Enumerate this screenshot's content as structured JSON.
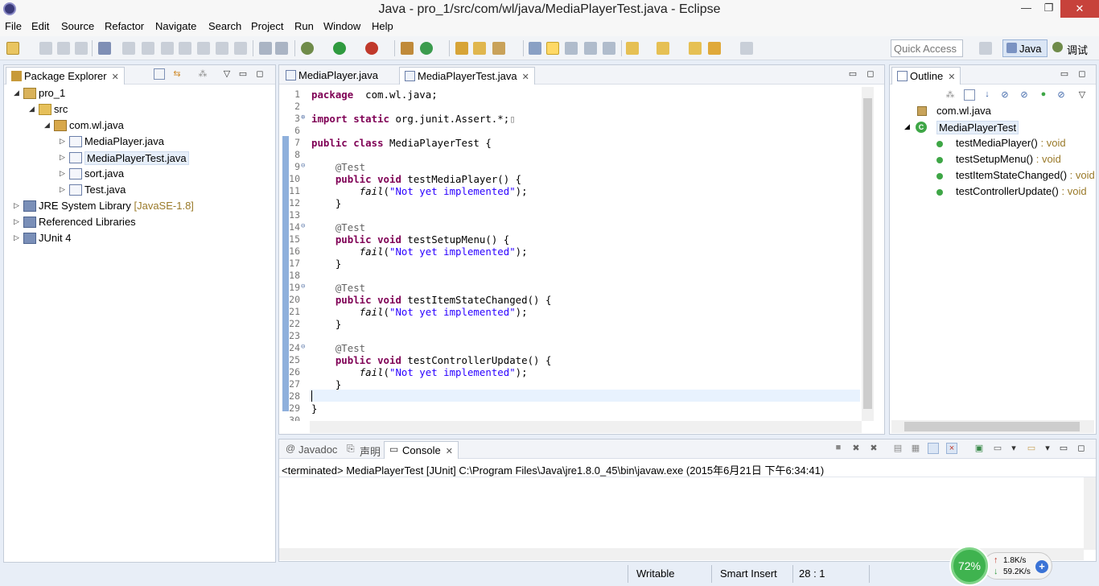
{
  "window": {
    "title": "Java - pro_1/src/com/wl/java/MediaPlayerTest.java - Eclipse",
    "minimize": "—",
    "maximize": "❐",
    "close": "✕"
  },
  "menu": [
    "File",
    "Edit",
    "Source",
    "Refactor",
    "Navigate",
    "Search",
    "Project",
    "Run",
    "Window",
    "Help"
  ],
  "toolbar": {
    "quick_access_placeholder": "Quick Access",
    "perspective_java": "Java",
    "perspective_debug": "调试"
  },
  "package_explorer": {
    "tab_label": "Package Explorer",
    "tree": [
      {
        "label": "pro_1",
        "twisty": "◢",
        "icon": "project-icon",
        "depth": 0
      },
      {
        "label": "src",
        "twisty": "◢",
        "icon": "source-folder-icon",
        "depth": 1
      },
      {
        "label": "com.wl.java",
        "twisty": "◢",
        "icon": "package-icon",
        "depth": 2
      },
      {
        "label": "MediaPlayer.java",
        "twisty": "▷",
        "icon": "java-file-icon",
        "depth": 3
      },
      {
        "label": "MediaPlayerTest.java",
        "twisty": "▷",
        "icon": "java-file-icon",
        "depth": 3,
        "selected": true
      },
      {
        "label": "sort.java",
        "twisty": "▷",
        "icon": "java-file-icon",
        "depth": 3
      },
      {
        "label": "Test.java",
        "twisty": "▷",
        "icon": "java-file-icon",
        "depth": 3
      },
      {
        "label": "JRE System Library",
        "decoration": "[JavaSE-1.8]",
        "twisty": "▷",
        "icon": "library-icon",
        "depth": 0
      },
      {
        "label": "Referenced Libraries",
        "twisty": "▷",
        "icon": "library-icon",
        "depth": 0
      },
      {
        "label": "JUnit 4",
        "twisty": "▷",
        "icon": "library-icon",
        "depth": 0
      }
    ]
  },
  "editor": {
    "tabs": [
      {
        "label": "MediaPlayer.java",
        "active": false
      },
      {
        "label": "MediaPlayerTest.java",
        "active": true
      }
    ],
    "lines": [
      {
        "n": "1",
        "parts": [
          [
            "kw",
            "package"
          ],
          [
            "",
            "  com.wl.java;"
          ]
        ]
      },
      {
        "n": "2",
        "parts": []
      },
      {
        "n": "3",
        "fold": "⊕",
        "parts": [
          [
            "kw",
            "import"
          ],
          [
            "",
            ""
          ],
          [
            "kw",
            " static"
          ],
          [
            "",
            " org.junit.Assert.*;"
          ],
          [
            "box",
            "▯"
          ]
        ]
      },
      {
        "n": "6",
        "parts": []
      },
      {
        "n": "7",
        "parts": [
          [
            "kw",
            "public"
          ],
          [
            "",
            ""
          ],
          [
            "kw",
            " class"
          ],
          [
            "",
            " MediaPlayerTest {"
          ]
        ]
      },
      {
        "n": "8",
        "parts": []
      },
      {
        "n": "9",
        "fold": "⊖",
        "parts": [
          [
            "",
            "    "
          ],
          [
            "ann",
            "@Test"
          ]
        ]
      },
      {
        "n": "10",
        "parts": [
          [
            "",
            "    "
          ],
          [
            "kw",
            "public"
          ],
          [
            "kw",
            " void"
          ],
          [
            "",
            " testMediaPlayer() {"
          ]
        ]
      },
      {
        "n": "11",
        "parts": [
          [
            "",
            "        "
          ],
          [
            "it",
            "fail"
          ],
          [
            "",
            "("
          ],
          [
            "str",
            "\"Not yet implemented\""
          ],
          [
            "",
            ");"
          ]
        ]
      },
      {
        "n": "12",
        "parts": [
          [
            "",
            "    }"
          ]
        ]
      },
      {
        "n": "13",
        "parts": []
      },
      {
        "n": "14",
        "fold": "⊖",
        "parts": [
          [
            "",
            "    "
          ],
          [
            "ann",
            "@Test"
          ]
        ]
      },
      {
        "n": "15",
        "parts": [
          [
            "",
            "    "
          ],
          [
            "kw",
            "public"
          ],
          [
            "kw",
            " void"
          ],
          [
            "",
            " testSetupMenu() {"
          ]
        ]
      },
      {
        "n": "16",
        "parts": [
          [
            "",
            "        "
          ],
          [
            "it",
            "fail"
          ],
          [
            "",
            "("
          ],
          [
            "str",
            "\"Not yet implemented\""
          ],
          [
            "",
            ");"
          ]
        ]
      },
      {
        "n": "17",
        "parts": [
          [
            "",
            "    }"
          ]
        ]
      },
      {
        "n": "18",
        "parts": []
      },
      {
        "n": "19",
        "fold": "⊖",
        "parts": [
          [
            "",
            "    "
          ],
          [
            "ann",
            "@Test"
          ]
        ]
      },
      {
        "n": "20",
        "parts": [
          [
            "",
            "    "
          ],
          [
            "kw",
            "public"
          ],
          [
            "kw",
            " void"
          ],
          [
            "",
            " testItemStateChanged() {"
          ]
        ]
      },
      {
        "n": "21",
        "parts": [
          [
            "",
            "        "
          ],
          [
            "it",
            "fail"
          ],
          [
            "",
            "("
          ],
          [
            "str",
            "\"Not yet implemented\""
          ],
          [
            "",
            ");"
          ]
        ]
      },
      {
        "n": "22",
        "parts": [
          [
            "",
            "    }"
          ]
        ]
      },
      {
        "n": "23",
        "parts": []
      },
      {
        "n": "24",
        "fold": "⊖",
        "parts": [
          [
            "",
            "    "
          ],
          [
            "ann",
            "@Test"
          ]
        ]
      },
      {
        "n": "25",
        "parts": [
          [
            "",
            "    "
          ],
          [
            "kw",
            "public"
          ],
          [
            "kw",
            " void"
          ],
          [
            "",
            " testControllerUpdate() {"
          ]
        ]
      },
      {
        "n": "26",
        "parts": [
          [
            "",
            "        "
          ],
          [
            "it",
            "fail"
          ],
          [
            "",
            "("
          ],
          [
            "str",
            "\"Not yet implemented\""
          ],
          [
            "",
            ");"
          ]
        ]
      },
      {
        "n": "27",
        "parts": [
          [
            "",
            "    }"
          ]
        ]
      },
      {
        "n": "28",
        "parts": [],
        "current": true
      },
      {
        "n": "29",
        "parts": [
          [
            "",
            "}"
          ]
        ]
      },
      {
        "n": "30",
        "parts": []
      }
    ]
  },
  "outline": {
    "tab_label": "Outline",
    "items": [
      {
        "label": "com.wl.java",
        "type": "",
        "icon": "package-declaration-icon",
        "depth": 0
      },
      {
        "label": "MediaPlayerTest",
        "type": "",
        "icon": "class-icon",
        "depth": 0,
        "selected": true
      },
      {
        "label": "testMediaPlayer()",
        "type": " : void",
        "icon": "public-method-icon",
        "depth": 1
      },
      {
        "label": "testSetupMenu()",
        "type": " : void",
        "icon": "public-method-icon",
        "depth": 1
      },
      {
        "label": "testItemStateChanged()",
        "type": " : void",
        "icon": "public-method-icon",
        "depth": 1
      },
      {
        "label": "testControllerUpdate()",
        "type": " : void",
        "icon": "public-method-icon",
        "depth": 1
      }
    ]
  },
  "console": {
    "tabs": [
      {
        "label": "Javadoc",
        "icon": "@"
      },
      {
        "label": "声明",
        "icon": "⎘"
      },
      {
        "label": "Console",
        "icon": "▭",
        "active": true
      }
    ],
    "header": "<terminated> MediaPlayerTest [JUnit] C:\\Program Files\\Java\\jre1.8.0_45\\bin\\javaw.exe (2015年6月21日 下午6:34:41)"
  },
  "statusbar": {
    "writable": "Writable",
    "insert_mode": "Smart Insert",
    "position": "28 : 1"
  },
  "netwidget": {
    "cpu": "72%",
    "upload": "1.8K/s",
    "download": "59.2K/s",
    "up_arrow": "↑",
    "down_arrow": "↓",
    "plus": "+"
  },
  "colors": {
    "keyword": "#7f0055",
    "string": "#2a00ff",
    "annotation": "#646464",
    "method_green": "#3ea646"
  }
}
